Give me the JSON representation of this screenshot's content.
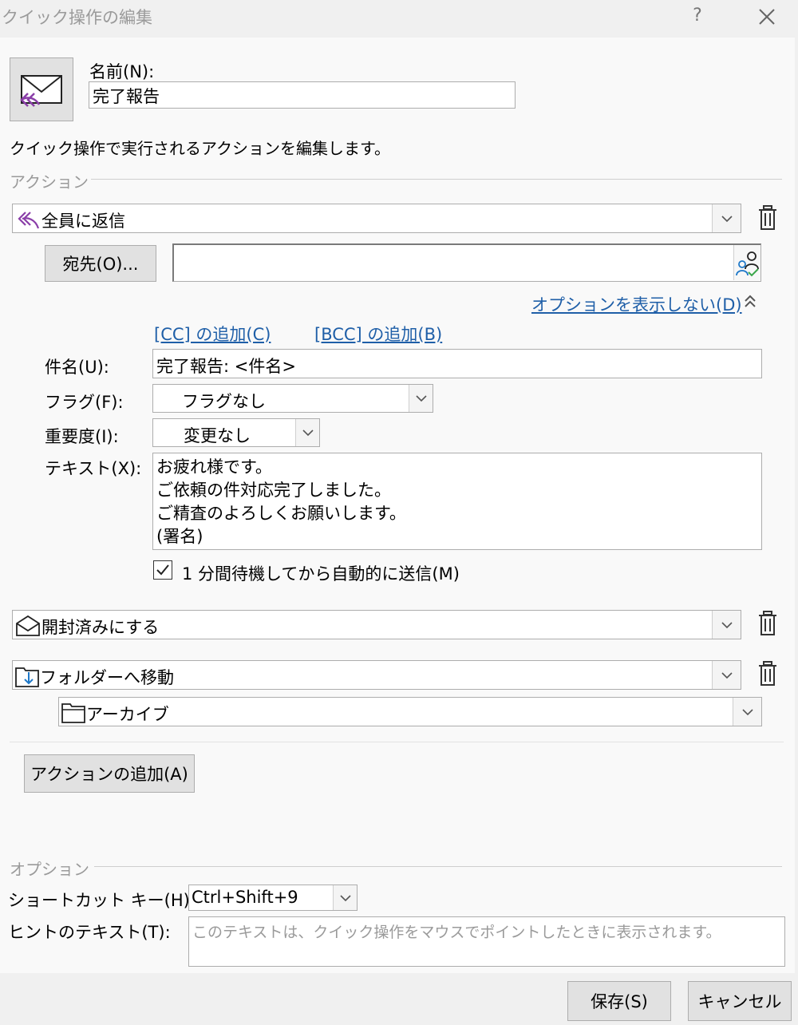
{
  "window": {
    "title": "クイック操作の編集",
    "help": "?"
  },
  "name_field": {
    "label": "名前(N):",
    "value": "完了報告"
  },
  "description": "クイック操作で実行されるアクションを編集します。",
  "actions_section": {
    "label": "アクション",
    "reply_all": {
      "value": "全員に返信",
      "to_button": "宛先(O)...",
      "to_value": "",
      "hide_options_link": "オプションを表示しない(D)",
      "add_cc_link": "[CC] の追加(C)",
      "add_bcc_link": "[BCC] の追加(B)",
      "subject_label": "件名(U):",
      "subject_value": "完了報告: <件名>",
      "flag_label": "フラグ(F):",
      "flag_value": "フラグなし",
      "importance_label": "重要度(I):",
      "importance_value": "変更なし",
      "text_label": "テキスト(X):",
      "text_lines": [
        "お疲れ様です。",
        "ご依頼の件対応完了しました。",
        "ご精査のよろしくお願いします。",
        "(署名)"
      ],
      "auto_send_checked": true,
      "auto_send_label": "1 分間待機してから自動的に送信(M)"
    },
    "mark_read": {
      "value": "開封済みにする"
    },
    "move_folder": {
      "value": "フォルダーへ移動",
      "folder_value": "アーカイブ"
    },
    "add_action_button": "アクションの追加(A)"
  },
  "options_section": {
    "label": "オプション",
    "shortcut_label": "ショートカット キー(H):",
    "shortcut_value": "Ctrl+Shift+9",
    "hint_label": "ヒントのテキスト(T):",
    "hint_placeholder": "このテキストは、クイック操作をマウスでポイントしたときに表示されます。"
  },
  "footer": {
    "save_button": "保存(S)",
    "cancel_button": "キャンセル"
  },
  "colors": {
    "accent_purple": "#8a3ea8",
    "link_blue": "#1f5fa8",
    "arrow_blue": "#1e78c8"
  }
}
